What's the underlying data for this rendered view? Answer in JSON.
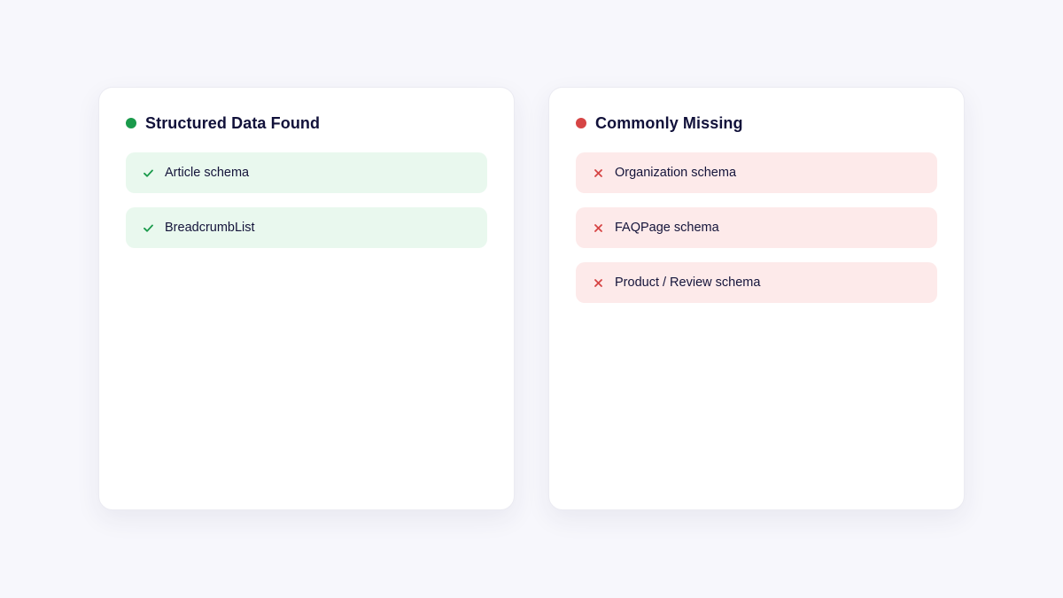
{
  "found": {
    "title": "Structured Data Found",
    "status_color": "#1a9a4b",
    "item_icon": "check-icon",
    "items": [
      {
        "label": "Article schema"
      },
      {
        "label": "BreadcrumbList"
      }
    ]
  },
  "missing": {
    "title": "Commonly Missing",
    "status_color": "#d64545",
    "item_icon": "cross-icon",
    "items": [
      {
        "label": "Organization schema"
      },
      {
        "label": "FAQPage schema"
      },
      {
        "label": "Product / Review schema"
      }
    ]
  }
}
